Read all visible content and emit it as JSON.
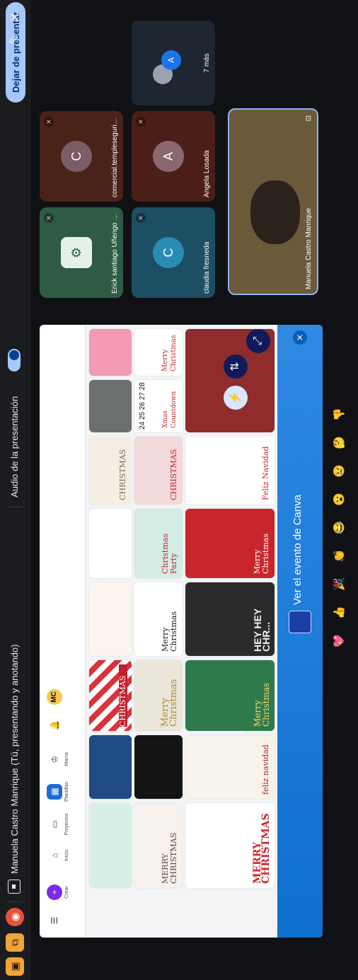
{
  "toolbar": {
    "presenting_text": "Manuela Castro Manrique (Tú, presentando y anotando)",
    "audio_label": "Audio de la presentación",
    "stop_presenting": "Dejar de presentar"
  },
  "shared_screen": {
    "banner_text": "Ver el evento de Canva",
    "rail": [
      {
        "label": "Crear",
        "icon": "plus-icon"
      },
      {
        "label": "Inicio",
        "icon": "home-icon"
      },
      {
        "label": "Proyectos",
        "icon": "folder-icon"
      },
      {
        "label": "Plantillas",
        "icon": "templates-icon"
      },
      {
        "label": "Marca",
        "icon": "brand-icon"
      },
      {
        "label": "",
        "icon": "bell-icon"
      },
      {
        "label": "MC",
        "icon": "avatar"
      }
    ],
    "tiles": {
      "merry_christmas_1": "MERRY CHRISTMAS",
      "merry_christmas_script": "Merry Christmas",
      "feliz_navidad": "feliz navidad",
      "merry_christmas_red": "Merry Christmas",
      "christmas_label": "CHRISTMAS",
      "christmas_party": "Christmas Party",
      "christmas_pink": "CHRISTMAS",
      "merry_christmas_green": "Merry Christmas",
      "hey_christmas": "HEY HEY CHR...",
      "xmas_countdown": "Xmas Countdown",
      "countdown_numbers": "24 25 26 27 28",
      "feliz_navidad_card": "Feliz Navidad",
      "merry_christmas_wreath": "MERRY CHRISTMAS",
      "merry_christmas_gold": "Merry Christmas",
      "merry_christmas_deer": "Merry Christmas",
      "christmas_red_stripes": "CHRISTMAS"
    }
  },
  "participants": [
    {
      "name": "Erick santiago Uñengo c...",
      "initial": ""
    },
    {
      "name": "comercial.templeseguridad ltda",
      "initial": "C"
    },
    {
      "name": "claudia fresneda",
      "initial": "C"
    },
    {
      "name": "Angela Losada",
      "initial": "A"
    },
    {
      "more": "7 más",
      "initial": "A"
    },
    {
      "name": "Manuela Castro Manrique",
      "initial": ""
    }
  ],
  "reactions": [
    "💖",
    "👍",
    "🎉",
    "👏",
    "😂",
    "😮",
    "😢",
    "🤔",
    "👎"
  ],
  "colors": {
    "toolbar_bg": "#1b1c20",
    "accent_orange": "#f2a33a",
    "stop_red": "#e5533d",
    "pill_blue": "#a8c7fa",
    "canva_blue": "#0f6fd0"
  }
}
